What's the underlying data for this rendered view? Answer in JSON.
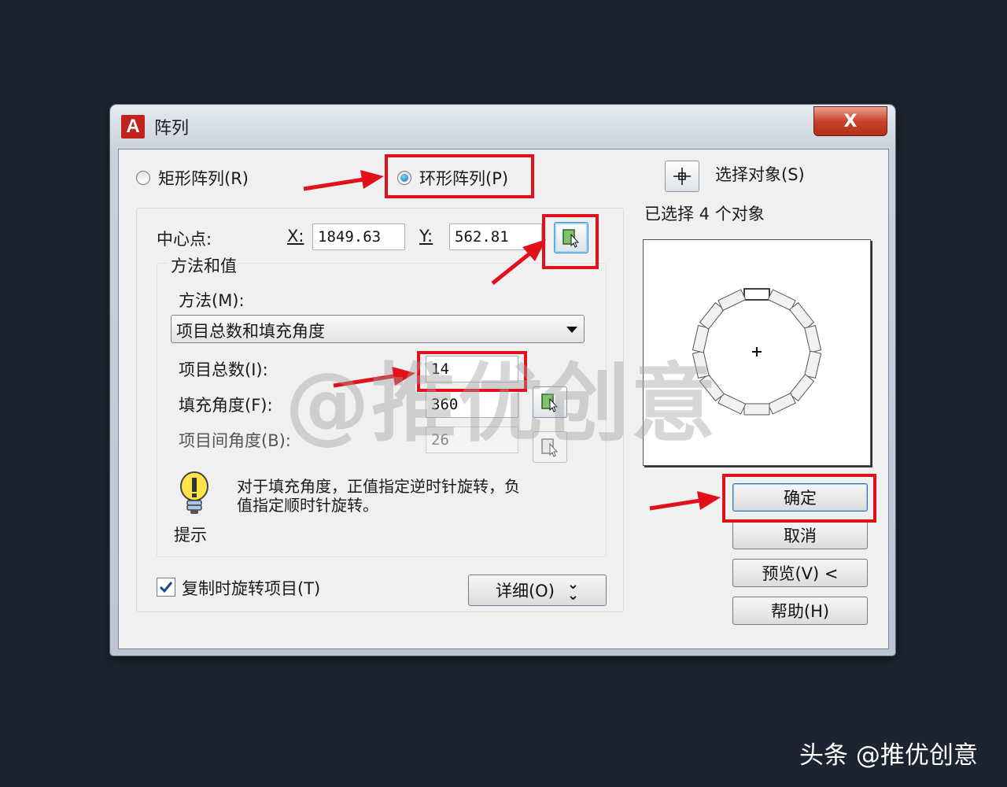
{
  "window": {
    "title": "阵列",
    "app_logo": "A",
    "close_label": "X"
  },
  "array_type": {
    "rectangular_label": "矩形阵列(R)",
    "polar_label": "环形阵列(P)",
    "selected": "polar"
  },
  "select_objects": {
    "label": "选择对象(S)",
    "status": "已选择 4 个对象"
  },
  "center_point": {
    "label": "中心点:",
    "x_label": "X:",
    "x_value": "1849.63",
    "y_label": "Y:",
    "y_value": "562.81"
  },
  "method_group": {
    "title": "方法和值",
    "method_label": "方法(M):",
    "method_value": "项目总数和填充角度",
    "total_items_label": "项目总数(I):",
    "total_items_value": "14",
    "fill_angle_label": "填充角度(F):",
    "fill_angle_value": "360",
    "item_angle_label": "项目间角度(B):",
    "item_angle_value": "26"
  },
  "tip": {
    "label": "提示",
    "text_line1": "对于填充角度，正值指定逆时针旋转，负",
    "text_line2": "值指定顺时针旋转。"
  },
  "rotate_items": {
    "label": "复制时旋转项目(T)",
    "checked": true
  },
  "details_button": {
    "label": "详细(O)",
    "icon": "double-chevron-down-icon"
  },
  "buttons": {
    "ok": "确定",
    "cancel": "取消",
    "preview": "预览(V) <",
    "help": "帮助(H)"
  },
  "watermark": "@推优创意",
  "footer_watermark": "头条 @推优创意",
  "colors": {
    "highlight_red": "#e3101b",
    "dialog_bg": "#f0f0f0",
    "close_button": "#c8432c"
  }
}
